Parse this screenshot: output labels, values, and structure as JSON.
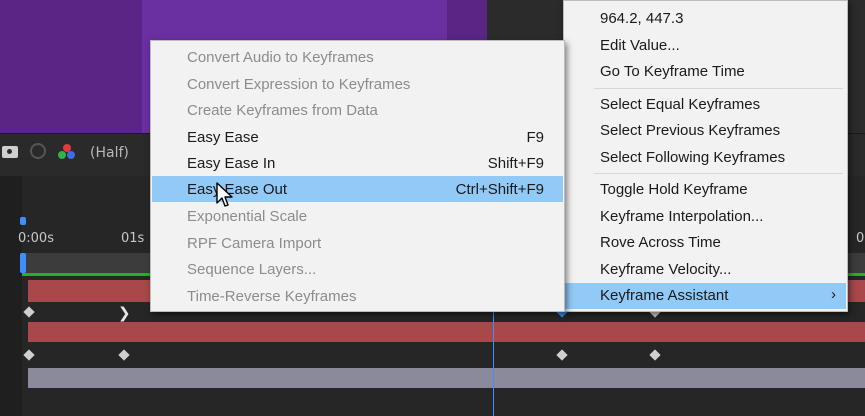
{
  "preview_bar": {
    "resolution": "(Half)"
  },
  "timeline": {
    "ruler_labels": [
      "0:00s",
      "01s",
      "0"
    ]
  },
  "submenu": {
    "items": [
      {
        "label": "Convert Audio to Keyframes",
        "shortcut": "",
        "state": "disabled"
      },
      {
        "label": "Convert Expression to Keyframes",
        "shortcut": "",
        "state": "disabled"
      },
      {
        "label": "Create Keyframes from Data",
        "shortcut": "",
        "state": "disabled"
      },
      {
        "label": "Easy Ease",
        "shortcut": "F9",
        "state": "enabled"
      },
      {
        "label": "Easy Ease In",
        "shortcut": "Shift+F9",
        "state": "enabled"
      },
      {
        "label": "Easy Ease Out",
        "shortcut": "Ctrl+Shift+F9",
        "state": "highlighted"
      },
      {
        "label": "Exponential Scale",
        "shortcut": "",
        "state": "disabled"
      },
      {
        "label": "RPF Camera Import",
        "shortcut": "",
        "state": "disabled"
      },
      {
        "label": "Sequence Layers...",
        "shortcut": "",
        "state": "disabled"
      },
      {
        "label": "Time-Reverse Keyframes",
        "shortcut": "",
        "state": "disabled"
      }
    ]
  },
  "main_menu": {
    "items": [
      {
        "label": "964.2, 447.3"
      },
      {
        "label": "Edit Value..."
      },
      {
        "label": "Go To Keyframe Time"
      },
      {
        "label": "Select Equal Keyframes"
      },
      {
        "label": "Select Previous Keyframes"
      },
      {
        "label": "Select Following Keyframes"
      },
      {
        "label": "Toggle Hold Keyframe"
      },
      {
        "label": "Keyframe Interpolation..."
      },
      {
        "label": "Rove Across Time"
      },
      {
        "label": "Keyframe Velocity..."
      },
      {
        "label": "Keyframe Assistant",
        "submenu_arrow": "›",
        "state": "highlighted"
      }
    ]
  },
  "colors": {
    "highlight": "#91c9f7",
    "menu_bg": "#f2f2f2",
    "cti": "#3e8eff",
    "layer_red": "#a8484a",
    "workarea_green": "#21b321",
    "preview_purple": "#6a2fa0"
  }
}
